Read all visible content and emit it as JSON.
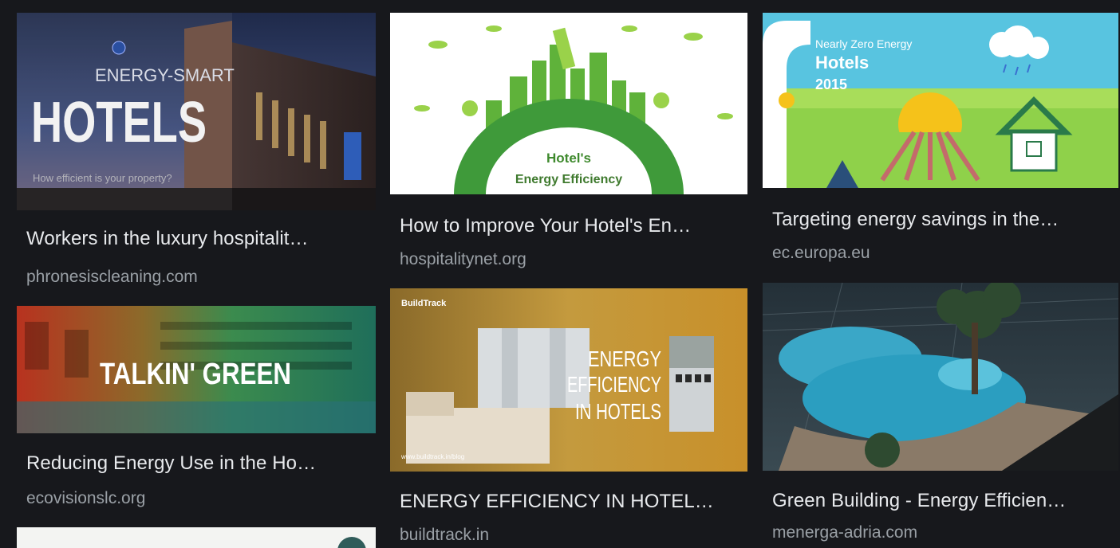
{
  "results": [
    {
      "title": "Workers in the luxury hospitalit…",
      "source": "phronesiscleaning.com",
      "image": {
        "overlay_small": "ENERGY-SMART",
        "overlay_big": "HOTELS",
        "overlay_caption": "How efficient is your property?"
      }
    },
    {
      "title": "How to Improve Your Hotel's En…",
      "source": "hospitalitynet.org",
      "image": {
        "overlay_line1": "Hotel's",
        "overlay_line2": "Energy Efficiency"
      }
    },
    {
      "title": "Targeting energy savings in the…",
      "source": "ec.europa.eu",
      "image": {
        "overlay_line1": "Nearly Zero Energy",
        "overlay_line2": "Hotels",
        "overlay_line3": "2015"
      }
    },
    {
      "title": "Reducing Energy Use in the Ho…",
      "source": "ecovisionslc.org",
      "image": {
        "overlay_text": "TALKIN' GREEN"
      }
    },
    {
      "title": "ENERGY EFFICIENCY IN HOTEL…",
      "source": "buildtrack.in",
      "image": {
        "brand": "BuildTrack",
        "line1": "ENERGY",
        "line2": "EFFICIENCY",
        "line3": "IN HOTELS",
        "url": "www.buildtrack.in/blog"
      }
    },
    {
      "title": "Green Building - Energy Efficien…",
      "source": "menerga-adria.com",
      "image": {}
    }
  ],
  "colors": {
    "background": "#17181c",
    "title": "#e8eaed",
    "source": "#9aa0a6"
  }
}
